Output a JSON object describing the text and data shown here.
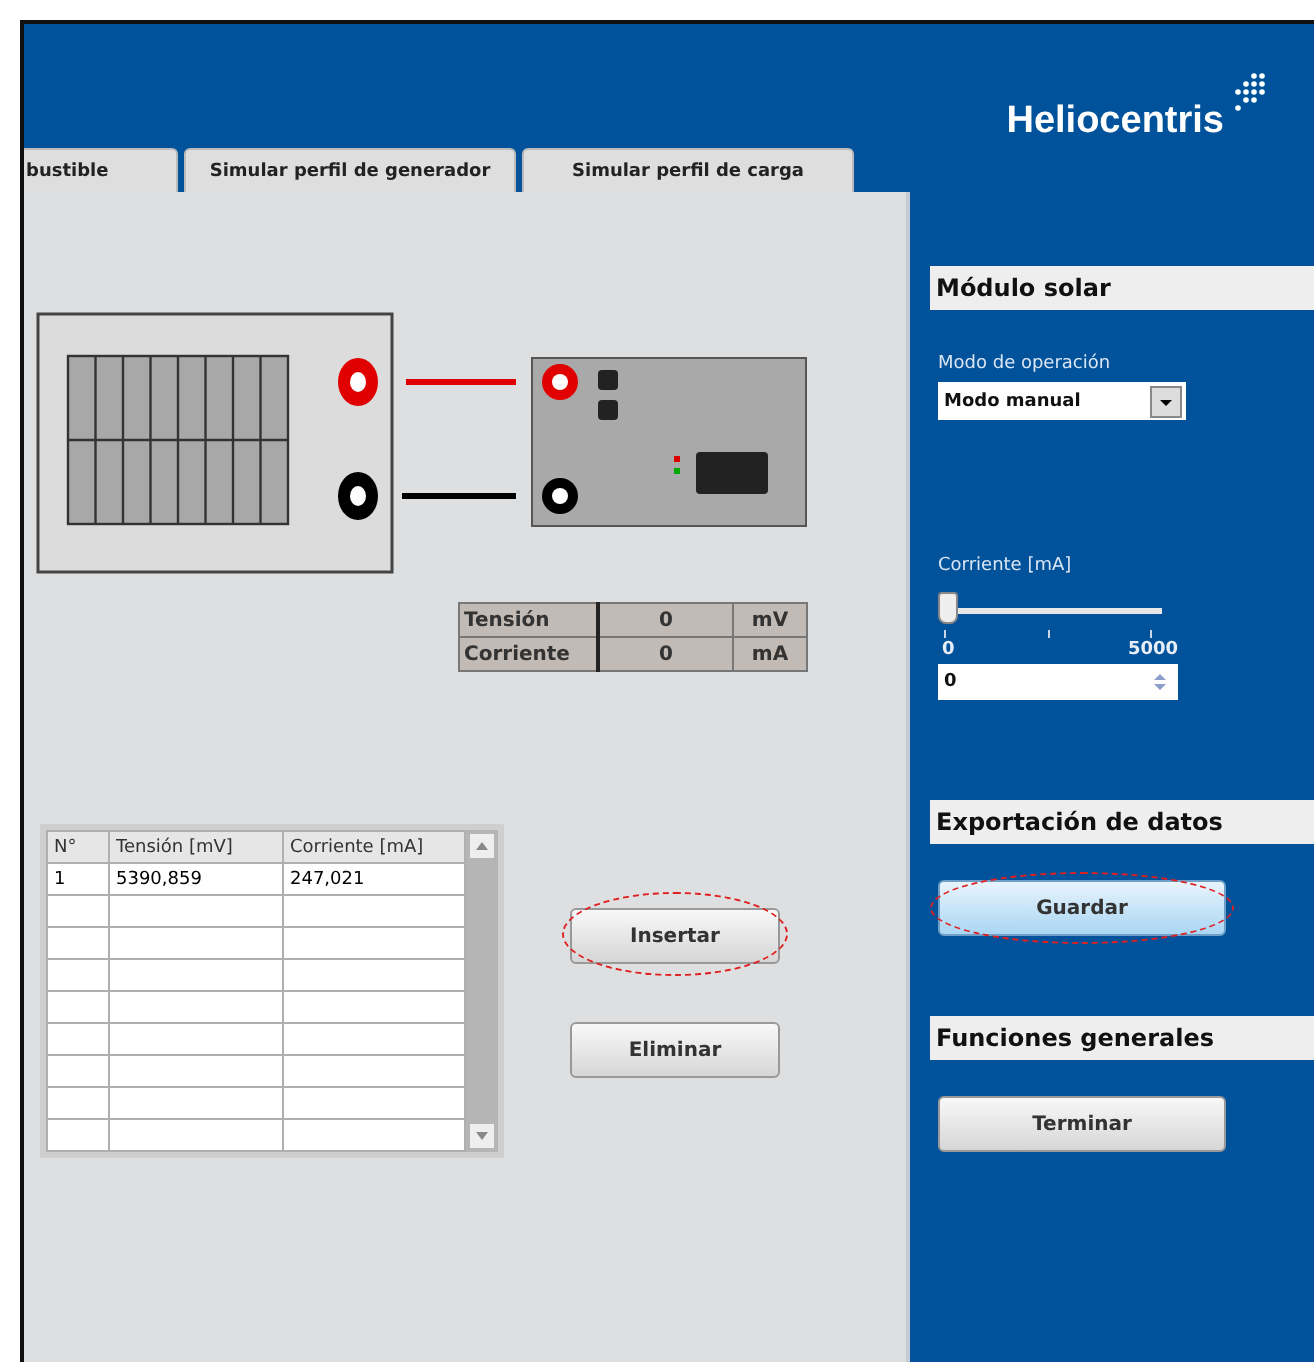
{
  "header": {
    "logo": "Heliocentris"
  },
  "tabs": [
    {
      "label": "bustible",
      "selected": false
    },
    {
      "label": "Simular perfil de generador",
      "selected": false
    },
    {
      "label": "Simular perfil de carga",
      "selected": false
    }
  ],
  "readings": [
    {
      "label": "Tensión",
      "value": "0",
      "unit": "mV"
    },
    {
      "label": "Corriente",
      "value": "0",
      "unit": "mA"
    }
  ],
  "table": {
    "columns": [
      "N°",
      "Tensión [mV]",
      "Corriente [mA]"
    ],
    "rows": [
      [
        "1",
        "5390,859",
        "247,021"
      ]
    ]
  },
  "actions": [
    {
      "label": "Insertar",
      "highlighted": true
    },
    {
      "label": "Eliminar",
      "highlighted": false
    }
  ],
  "sidebar": {
    "sections": [
      {
        "title": "Módulo solar",
        "controls": [
          {
            "kind": "dropdown",
            "label": "Modo de operación",
            "value": "Modo manual"
          },
          {
            "kind": "slider",
            "label": "Corriente [mA]",
            "level": 0,
            "min_label": "0",
            "max_label": "5000",
            "value": "0"
          }
        ]
      },
      {
        "title": "Exportación de datos",
        "controls": [
          {
            "kind": "button",
            "label": "Guardar",
            "highlighted": true,
            "focused": true
          }
        ]
      },
      {
        "title": "Funciones generales",
        "controls": [
          {
            "kind": "button",
            "label": "Terminar",
            "highlighted": false,
            "focused": false
          }
        ]
      }
    ]
  }
}
